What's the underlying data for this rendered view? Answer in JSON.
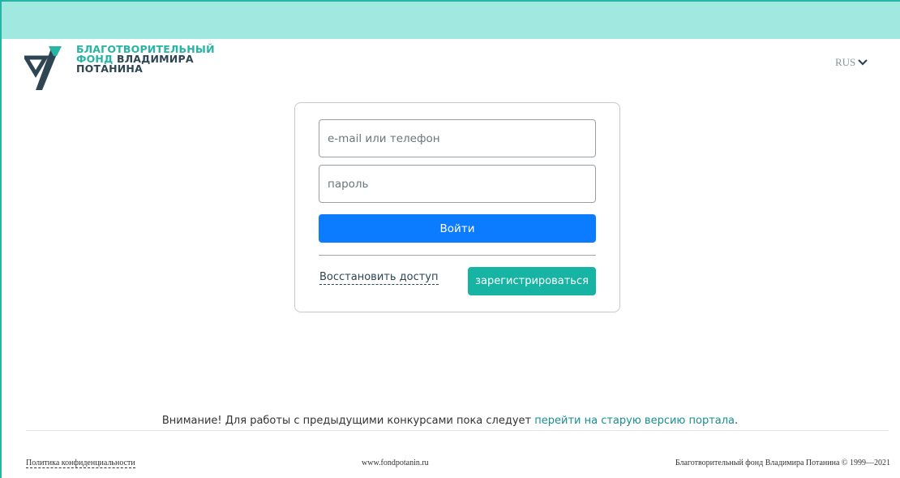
{
  "header": {
    "logo": {
      "line1": "БЛАГОТВОРИТЕЛЬНЫЙ",
      "line2_teal": "ФОНД",
      "line2_dark": "ВЛАДИМИРА",
      "line3": "ПОТАНИНА"
    },
    "language": "RUS"
  },
  "login": {
    "email_placeholder": "e-mail или телефон",
    "password_placeholder": "пароль",
    "login_button": "Войти",
    "restore_link": "Восстановить доступ",
    "register_button": "зарегистрироваться"
  },
  "notice": {
    "text": "Внимание! Для работы с предыдущими конкурсами пока следует ",
    "link": "перейти на старую версию портала",
    "end": "."
  },
  "footer": {
    "privacy": "Политика конфиденциальности",
    "site": "www.fondpotanin.ru",
    "copyright": "Благотворительный фонд Владимира Потанина © 1999—2021"
  },
  "colors": {
    "accent_teal": "#17b3a3",
    "topbar": "#a1e8e0",
    "primary_blue": "#0b7bff"
  }
}
